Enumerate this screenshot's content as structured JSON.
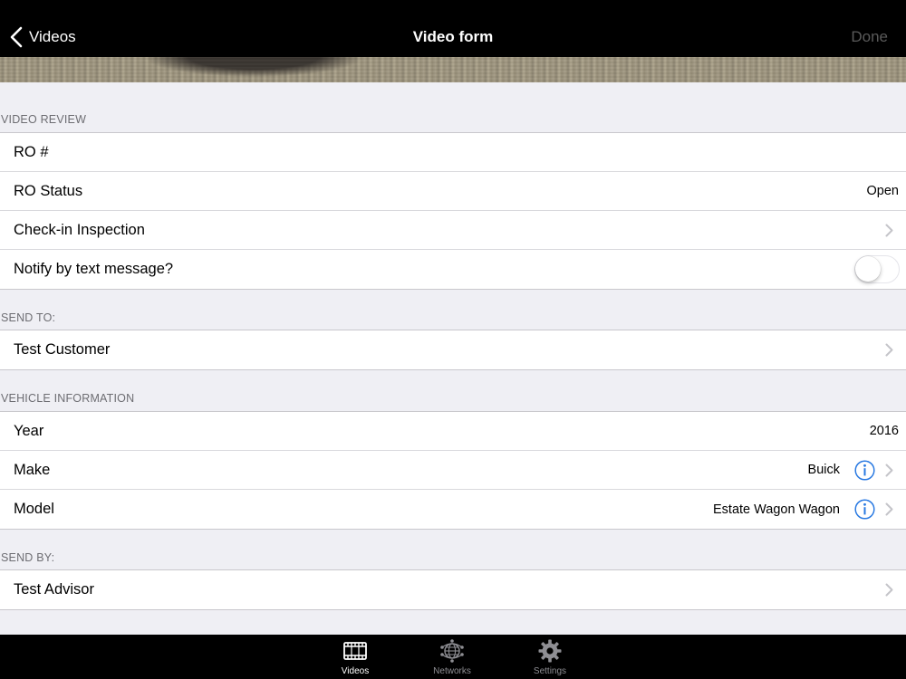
{
  "navbar": {
    "back_label": "Videos",
    "title": "Video form",
    "done_label": "Done"
  },
  "sections": {
    "video_review": {
      "header": "VIDEO REVIEW",
      "ro_number_label": "RO #",
      "ro_status_label": "RO Status",
      "ro_status_value": "Open",
      "checkin_label": "Check-in Inspection",
      "notify_label": "Notify by text message?",
      "notify_on": false
    },
    "send_to": {
      "header": "SEND TO:",
      "customer": "Test Customer"
    },
    "vehicle_information": {
      "header": "VEHICLE INFORMATION",
      "year_label": "Year",
      "year_value": "2016",
      "make_label": "Make",
      "make_value": "Buick",
      "model_label": "Model",
      "model_value": "Estate Wagon Wagon"
    },
    "send_by": {
      "header": "SEND BY:",
      "advisor": "Test Advisor"
    }
  },
  "tabbar": {
    "tabs": [
      {
        "label": "Videos",
        "icon": "film-icon",
        "active": true
      },
      {
        "label": "Networks",
        "icon": "globe-network-icon",
        "active": false
      },
      {
        "label": "Settings",
        "icon": "gear-icon",
        "active": false
      }
    ]
  },
  "colors": {
    "accent": "#2a7ae2",
    "tab_active": "#ffffff",
    "tab_inactive": "#8e8e93",
    "section_header": "#6d6d72"
  }
}
